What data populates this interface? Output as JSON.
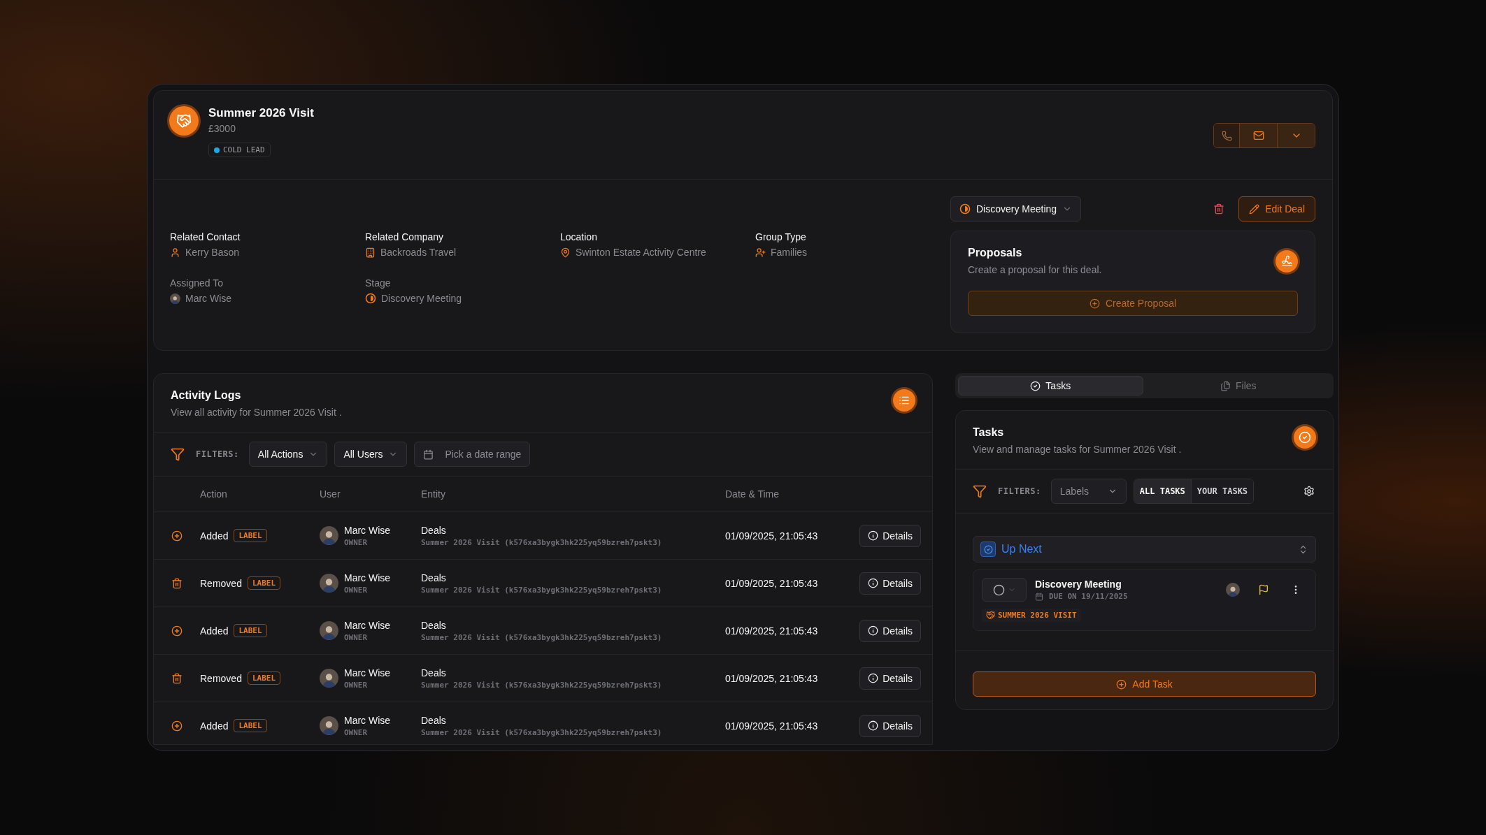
{
  "deal": {
    "title": "Summer 2026 Visit",
    "amount": "£3000",
    "status": {
      "label": "COLD LEAD",
      "color": "#1ea7e4"
    }
  },
  "details": [
    {
      "kind": "contact",
      "label": "Related Contact",
      "value": "Kerry Bason"
    },
    {
      "kind": "company",
      "label": "Related Company",
      "value": "Backroads Travel"
    },
    {
      "kind": "location",
      "label": "Location",
      "value": "Swinton Estate Activity Centre"
    },
    {
      "kind": "group",
      "label": "Group Type",
      "value": "Families"
    },
    {
      "kind": "user",
      "label": "Assigned To",
      "value": "Marc Wise"
    },
    {
      "kind": "stage",
      "label": "Stage",
      "value": "Discovery Meeting"
    }
  ],
  "stage_select": {
    "value": "Discovery Meeting"
  },
  "edit_button": "Edit Deal",
  "proposals": {
    "title": "Proposals",
    "subtitle": "Create a proposal for this deal.",
    "button": "Create Proposal"
  },
  "activity": {
    "title": "Activity Logs",
    "subtitle": "View all activity for Summer 2026 Visit .",
    "filters_label": "FILTERS:",
    "filters": [
      {
        "kind": "select",
        "value": "All Actions"
      },
      {
        "kind": "select",
        "value": "All Users"
      },
      {
        "kind": "date",
        "placeholder": "Pick a date range"
      }
    ],
    "columns": [
      "Action",
      "User",
      "Entity",
      "Date & Time"
    ],
    "rows": [
      {
        "kind": "added",
        "action": "Added",
        "tag": "LABEL",
        "user": "Marc Wise",
        "role": "OWNER",
        "entity": "Deals",
        "entity_detail": "Summer 2026 Visit (k576xa3bygk3hk225yq59bzreh7pskt3)",
        "datetime": "01/09/2025, 21:05:43",
        "button": "Details"
      },
      {
        "kind": "removed",
        "action": "Removed",
        "tag": "LABEL",
        "user": "Marc Wise",
        "role": "OWNER",
        "entity": "Deals",
        "entity_detail": "Summer 2026 Visit (k576xa3bygk3hk225yq59bzreh7pskt3)",
        "datetime": "01/09/2025, 21:05:43",
        "button": "Details"
      },
      {
        "kind": "added",
        "action": "Added",
        "tag": "LABEL",
        "user": "Marc Wise",
        "role": "OWNER",
        "entity": "Deals",
        "entity_detail": "Summer 2026 Visit (k576xa3bygk3hk225yq59bzreh7pskt3)",
        "datetime": "01/09/2025, 21:05:43",
        "button": "Details"
      },
      {
        "kind": "removed",
        "action": "Removed",
        "tag": "LABEL",
        "user": "Marc Wise",
        "role": "OWNER",
        "entity": "Deals",
        "entity_detail": "Summer 2026 Visit (k576xa3bygk3hk225yq59bzreh7pskt3)",
        "datetime": "01/09/2025, 21:05:43",
        "button": "Details"
      },
      {
        "kind": "added",
        "action": "Added",
        "tag": "LABEL",
        "user": "Marc Wise",
        "role": "OWNER",
        "entity": "Deals",
        "entity_detail": "Summer 2026 Visit (k576xa3bygk3hk225yq59bzreh7pskt3)",
        "datetime": "01/09/2025, 21:05:43",
        "button": "Details"
      }
    ]
  },
  "side_tabs": [
    {
      "kind": "tasks",
      "label": "Tasks",
      "selected": true
    },
    {
      "kind": "files",
      "label": "Files",
      "selected": false
    }
  ],
  "tasks": {
    "title": "Tasks",
    "subtitle": "View and manage tasks for Summer 2026 Visit .",
    "filters_label": "FILTERS:",
    "labels_select": {
      "placeholder": "Labels"
    },
    "scope": [
      {
        "label": "ALL TASKS",
        "selected": true
      },
      {
        "label": "YOUR TASKS",
        "selected": false
      }
    ],
    "group": {
      "title": "Up Next"
    },
    "items": [
      {
        "title": "Discovery Meeting",
        "due": "DUE ON 19/11/2025",
        "tag": "SUMMER 2026 VISIT",
        "done": false
      }
    ],
    "add_button": "Add Task"
  }
}
